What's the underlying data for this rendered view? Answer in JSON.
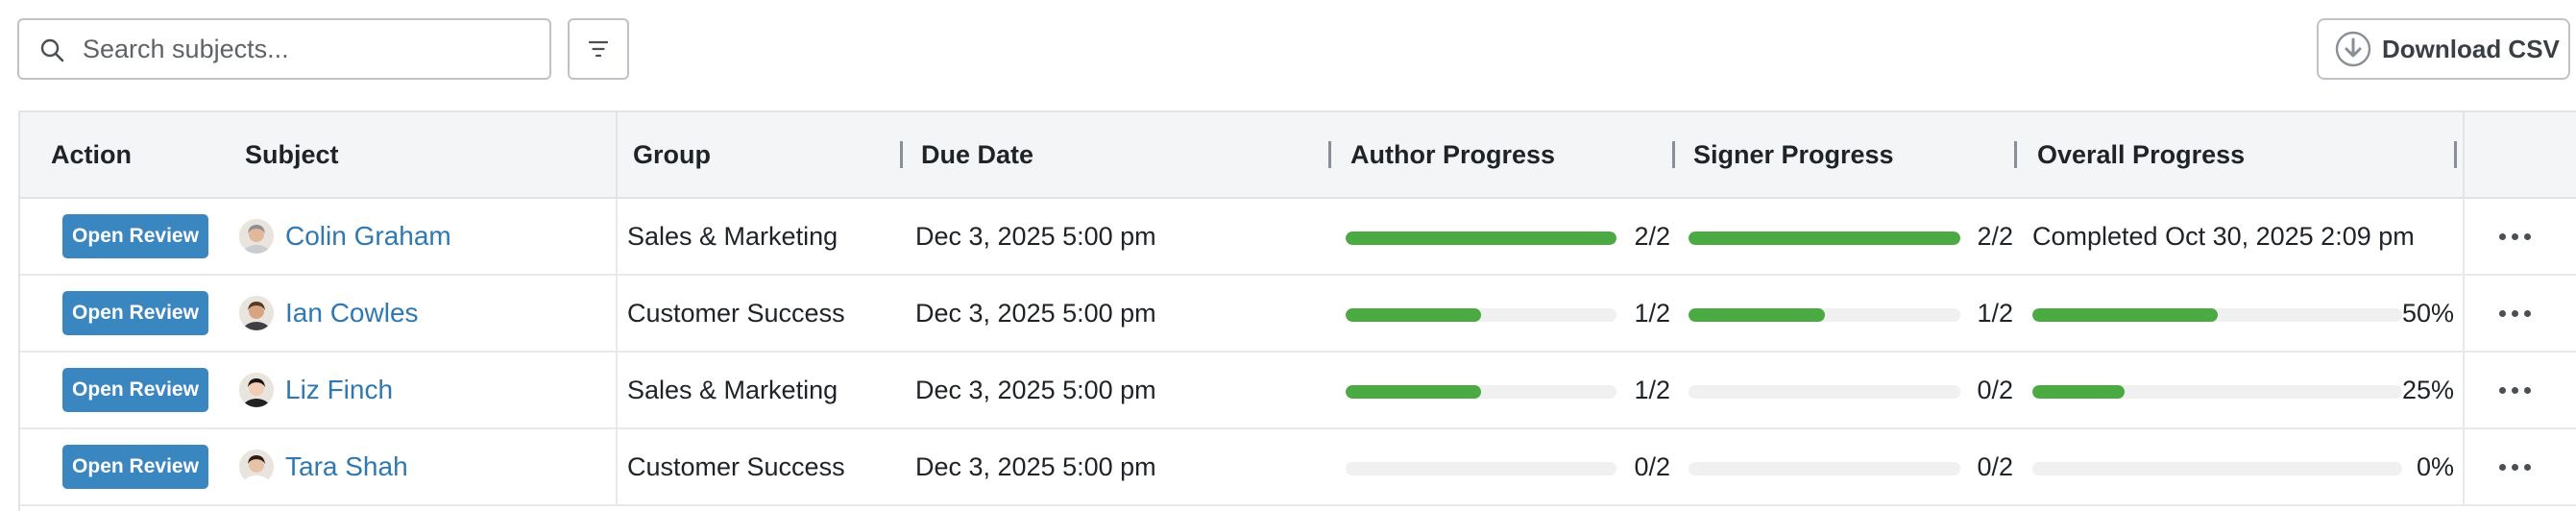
{
  "toolbar": {
    "search_placeholder": "Search subjects...",
    "download_label": "Download CSV",
    "icons": {
      "search": "search-icon",
      "filter": "filter-icon",
      "download": "download-icon"
    }
  },
  "table": {
    "headers": {
      "action": "Action",
      "subject": "Subject",
      "group": "Group",
      "due_date": "Due Date",
      "author_progress": "Author Progress",
      "signer_progress": "Signer Progress",
      "overall_progress": "Overall Progress"
    },
    "rows": [
      {
        "action_label": "Open Review",
        "subject": "Colin Graham",
        "group": "Sales & Marketing",
        "due_date": "Dec 3, 2025 5:00 pm",
        "author_progress": {
          "fraction": 1.0,
          "label": "2/2"
        },
        "signer_progress": {
          "fraction": 1.0,
          "label": "2/2"
        },
        "overall": {
          "completed": true,
          "text": "Completed Oct 30, 2025 2:09 pm"
        }
      },
      {
        "action_label": "Open Review",
        "subject": "Ian Cowles",
        "group": "Customer Success",
        "due_date": "Dec 3, 2025 5:00 pm",
        "author_progress": {
          "fraction": 0.5,
          "label": "1/2"
        },
        "signer_progress": {
          "fraction": 0.5,
          "label": "1/2"
        },
        "overall": {
          "completed": false,
          "fraction": 0.5,
          "text": "50%"
        }
      },
      {
        "action_label": "Open Review",
        "subject": "Liz Finch",
        "group": "Sales & Marketing",
        "due_date": "Dec 3, 2025 5:00 pm",
        "author_progress": {
          "fraction": 0.5,
          "label": "1/2"
        },
        "signer_progress": {
          "fraction": 0.0,
          "label": "0/2"
        },
        "overall": {
          "completed": false,
          "fraction": 0.25,
          "text": "25%"
        }
      },
      {
        "action_label": "Open Review",
        "subject": "Tara Shah",
        "group": "Customer Success",
        "due_date": "Dec 3, 2025 5:00 pm",
        "author_progress": {
          "fraction": 0.0,
          "label": "0/2"
        },
        "signer_progress": {
          "fraction": 0.0,
          "label": "0/2"
        },
        "overall": {
          "completed": false,
          "fraction": 0.0,
          "text": "0%"
        }
      }
    ]
  },
  "colors": {
    "accent_button": "#3a86c1",
    "link": "#2e78b3",
    "progress_fill": "#4caa43",
    "progress_track": "#f0f0f0"
  }
}
